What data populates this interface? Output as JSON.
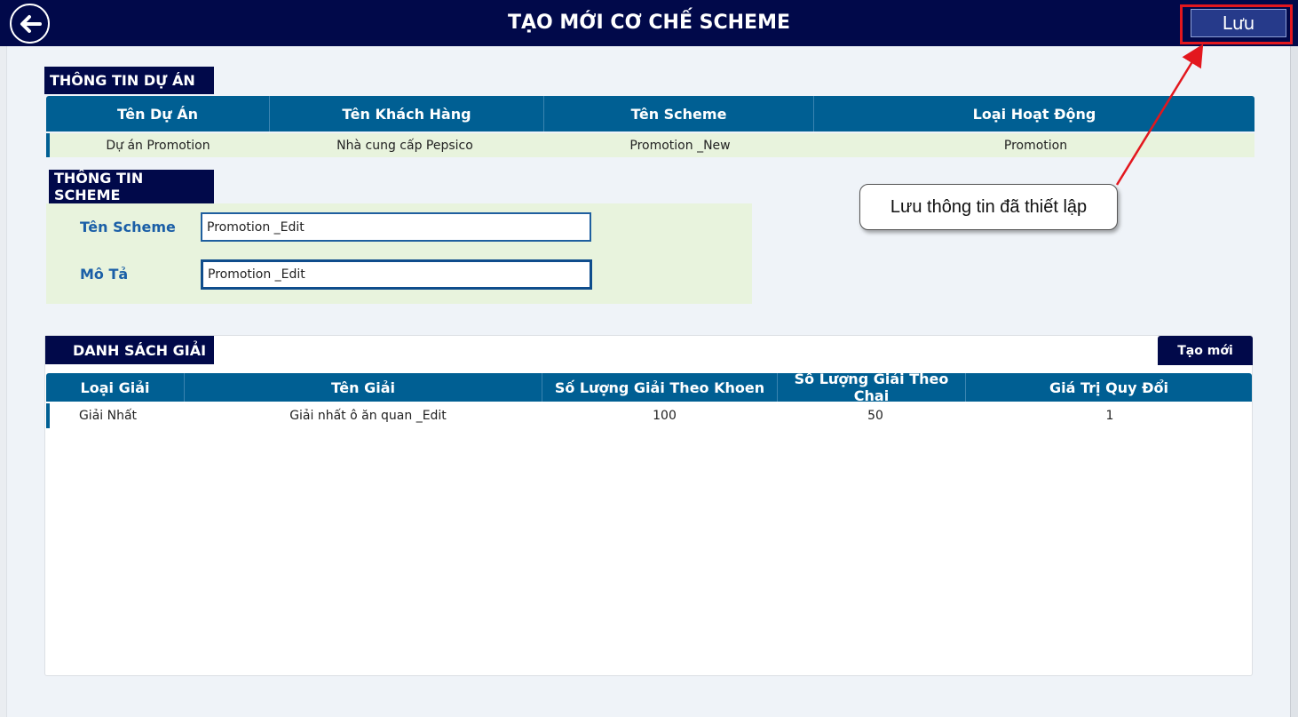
{
  "header": {
    "title": "TẠO MỚI CƠ CHẾ SCHEME",
    "save_label": "Lưu"
  },
  "project_info": {
    "section_label": "THÔNG TIN DỰ ÁN",
    "columns": [
      "Tên Dự Án",
      "Tên Khách Hàng",
      "Tên Scheme",
      "Loại Hoạt Động"
    ],
    "row": [
      "Dự án Promotion",
      "Nhà cung cấp Pepsico",
      "Promotion _New",
      "Promotion"
    ]
  },
  "scheme_info": {
    "section_label": "THÔNG TIN SCHEME",
    "name_label": "Tên Scheme",
    "name_value": "Promotion _Edit",
    "desc_label": "Mô Tả",
    "desc_value": "Promotion _Edit"
  },
  "callout": {
    "text": "Lưu thông tin đã thiết lập"
  },
  "prize_list": {
    "section_label": "DANH SÁCH GIẢI",
    "create_label": "Tạo mới",
    "columns": [
      "Loại Giải",
      "Tên Giải",
      "Số Lượng Giải Theo Khoen",
      "Số Lượng Giải Theo Chai",
      "Giá Trị Quy Đổi"
    ],
    "rows": [
      [
        "Giải Nhất",
        "Giải nhất ô ăn quan _Edit",
        "100",
        "50",
        "1"
      ]
    ]
  },
  "colors": {
    "navy": "#01094a",
    "table_header": "#005f93",
    "light_green": "#e8f3dd",
    "highlight_red": "#e3171e",
    "label_blue": "#1b5fa7"
  },
  "icons": {
    "back": "arrow-left-circle-icon"
  }
}
